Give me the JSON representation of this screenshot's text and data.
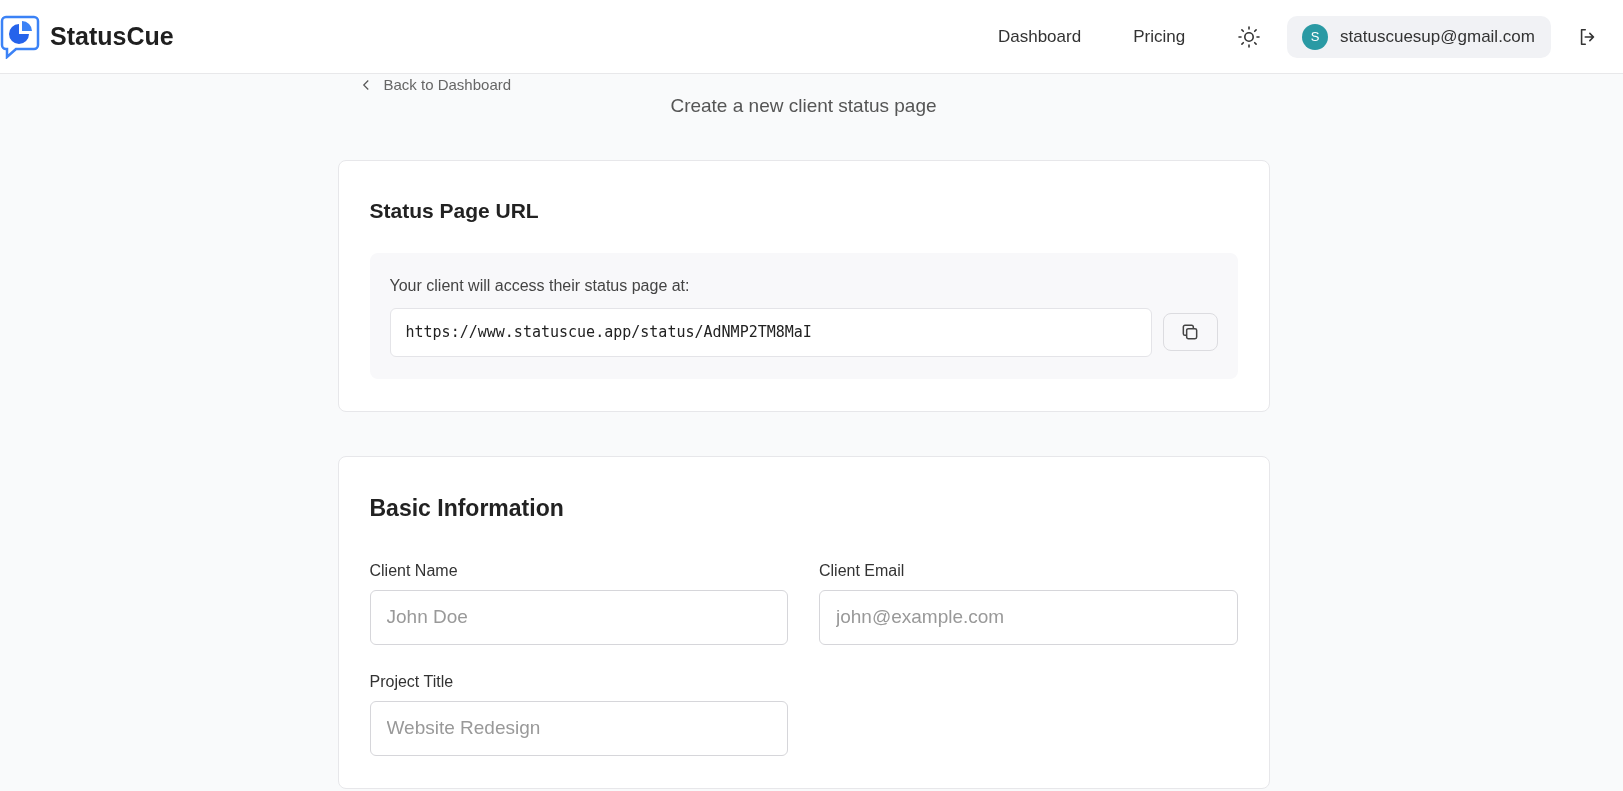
{
  "header": {
    "brand": "StatusCue",
    "nav": [
      {
        "label": "Dashboard"
      },
      {
        "label": "Pricing"
      }
    ],
    "user": {
      "initial": "S",
      "email": "statuscuesup@gmail.com"
    }
  },
  "back_link": "Back to Dashboard",
  "subtitle": "Create a new client status page",
  "url_card": {
    "title": "Status Page URL",
    "hint": "Your client will access their status page at:",
    "url": "https://www.statuscue.app/status/AdNMP2TM8MaI"
  },
  "info_card": {
    "title": "Basic Information",
    "fields": [
      {
        "label": "Client Name",
        "placeholder": "John Doe"
      },
      {
        "label": "Client Email",
        "placeholder": "john@example.com"
      },
      {
        "label": "Project Title",
        "placeholder": "Website Redesign"
      }
    ]
  }
}
